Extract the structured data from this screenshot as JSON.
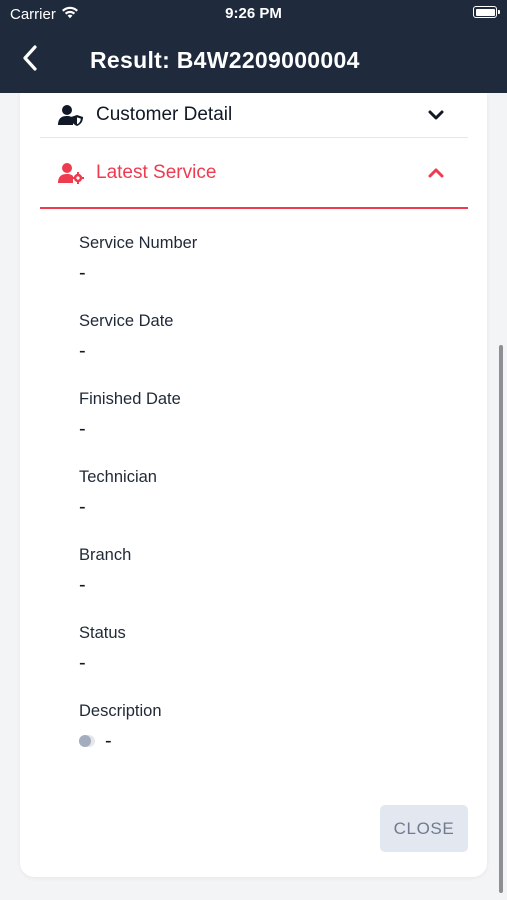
{
  "statusbar": {
    "carrier": "Carrier",
    "time": "9:26 PM"
  },
  "header": {
    "title": "Result: B4W2209000004"
  },
  "sections": {
    "customer_detail": {
      "label": "Customer Detail",
      "expanded": false
    },
    "latest_service": {
      "label": "Latest Service",
      "expanded": true
    }
  },
  "fields": [
    {
      "label": "Service Number",
      "value": "-"
    },
    {
      "label": "Service Date",
      "value": "-"
    },
    {
      "label": "Finished Date",
      "value": "-"
    },
    {
      "label": "Technician",
      "value": "-"
    },
    {
      "label": "Branch",
      "value": "-"
    },
    {
      "label": "Status",
      "value": "-"
    },
    {
      "label": "Description",
      "value": "-"
    }
  ],
  "actions": {
    "close_label": "CLOSE"
  },
  "colors": {
    "header_bg": "#1f2a3c",
    "accent": "#ef3b4f",
    "button_bg": "#e3e8f0",
    "button_text": "#707b8f"
  },
  "icons": {
    "back": "chevron-left-icon",
    "customer": "user-shield-icon",
    "service": "user-gear-icon",
    "collapse": "chevron-down-icon",
    "expand": "chevron-up-icon"
  }
}
